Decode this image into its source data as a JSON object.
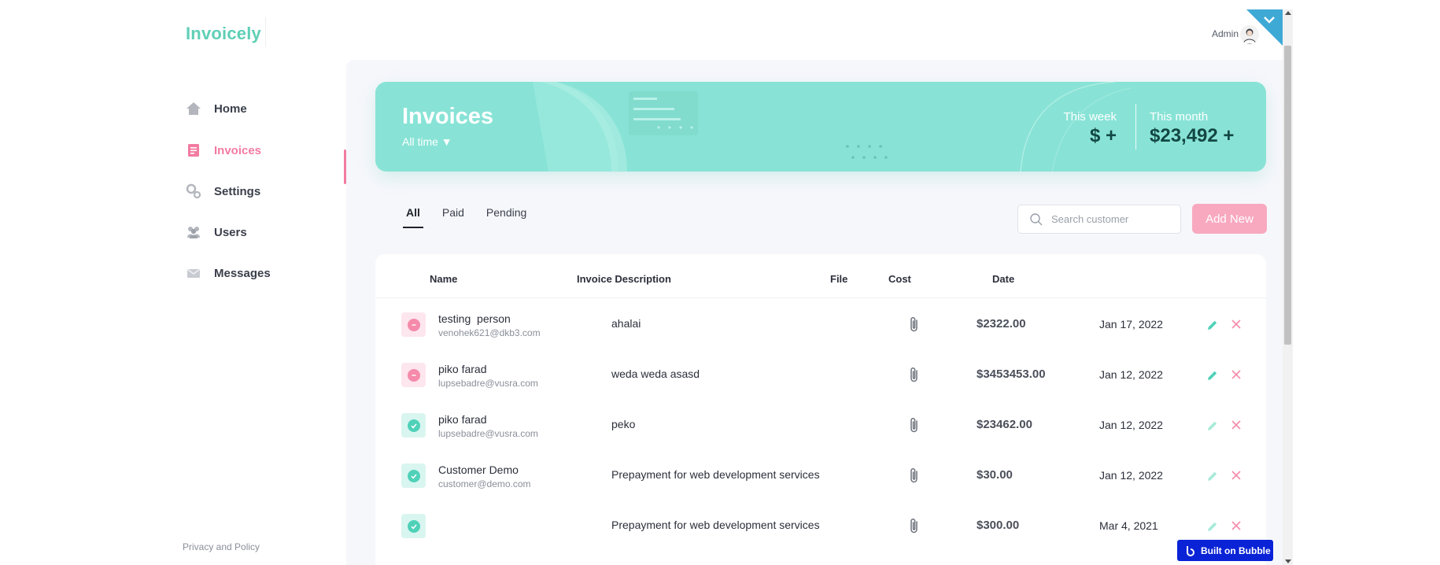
{
  "app": {
    "logo": "Invoicely",
    "user_label": "Admin"
  },
  "colors": {
    "brand": "#5fcfb6",
    "accent_pink": "#f37ba1",
    "banner": "#88e3d6",
    "add_button": "#f8a9c0",
    "paid": "#4fd1b8",
    "pending": "#f58aab"
  },
  "sidebar": {
    "items": [
      {
        "label": "Home",
        "icon": "home-icon"
      },
      {
        "label": "Invoices",
        "icon": "invoice-icon",
        "active": true
      },
      {
        "label": "Settings",
        "icon": "gear-icon"
      },
      {
        "label": "Users",
        "icon": "users-icon"
      },
      {
        "label": "Messages",
        "icon": "mail-icon"
      }
    ],
    "footer_link": "Privacy and Policy"
  },
  "banner": {
    "title": "Invoices",
    "period": "All time ▼",
    "week_label": "This week",
    "week_value": "$ +",
    "month_label": "This month",
    "month_value": "$23,492 +"
  },
  "tabs": [
    {
      "label": "All",
      "active": true
    },
    {
      "label": "Paid"
    },
    {
      "label": "Pending"
    }
  ],
  "search": {
    "placeholder": "Search customer",
    "value": ""
  },
  "add_button": "Add New",
  "table": {
    "headers": {
      "name": "Name",
      "description": "Invoice Description",
      "file": "File",
      "cost": "Cost",
      "date": "Date"
    },
    "rows": [
      {
        "status": "pending",
        "name": "testing  person",
        "email": "venohek621@dkb3.com",
        "description": "ahalai",
        "cost": "$2322.00",
        "date": "Jan 17, 2022"
      },
      {
        "status": "pending",
        "name": "piko farad",
        "email": "lupsebadre@vusra.com",
        "description": "weda weda asasd",
        "cost": "$3453453.00",
        "date": "Jan 12, 2022"
      },
      {
        "status": "paid",
        "name": "piko farad",
        "email": "lupsebadre@vusra.com",
        "description": "peko",
        "cost": "$23462.00",
        "date": "Jan 12, 2022"
      },
      {
        "status": "paid",
        "name": "Customer Demo",
        "email": "customer@demo.com",
        "description": "Prepayment for web development services",
        "cost": "$30.00",
        "date": "Jan 12, 2022"
      },
      {
        "status": "paid",
        "name": "",
        "email": "",
        "description": "Prepayment for web development services",
        "cost": "$300.00",
        "date": "Mar 4, 2021"
      }
    ]
  },
  "badge": "Built on Bubble"
}
